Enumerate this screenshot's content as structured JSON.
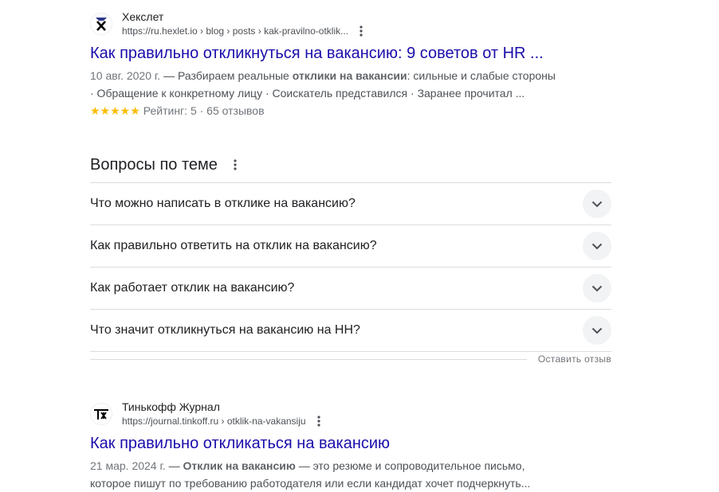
{
  "results": [
    {
      "site": "Хекслет",
      "url": "https://ru.hexlet.io › blog › posts › kak-pravilno-otklik...",
      "title": "Как правильно откликнуться на вакансию: 9 советов от HR ...",
      "date": "10 авг. 2020 г.",
      "dash": " — ",
      "snippet_pre": "Разбираем реальные ",
      "snippet_bold": "отклики на вакансии",
      "snippet_post": ": сильные и слабые стороны",
      "snippet_line2": "· Обращение к конкретному лицу · Соискатель представился · Заранее прочитал ...",
      "stars": "★★★★★",
      "rating_text": "Рейтинг: 5 · 65 отзывов"
    },
    {
      "site": "Тинькофф Журнал",
      "url": "https://journal.tinkoff.ru › otklik-na-vakansiju",
      "title": "Как правильно откликаться на вакансию",
      "date": "21 мар. 2024 г.",
      "dash": " — ",
      "snippet_bold": "Отклик на вакансию",
      "snippet_post": " — это резюме и сопроводительное письмо,",
      "snippet_line2": "которое пишут по требованию работодателя или если кандидат хочет подчеркнуть..."
    }
  ],
  "paa": {
    "title": "Вопросы по теме",
    "questions": [
      "Что можно написать в отклике на вакансию?",
      "Как правильно ответить на отклик на вакансию?",
      "Как работает отклик на вакансию?",
      "Что значит откликнуться на вакансию на HH?"
    ],
    "feedback": "Оставить отзыв"
  },
  "colors": {
    "link": "#1a0dab",
    "star": "#fbbc04",
    "text": "#202124",
    "muted": "#4d5156"
  }
}
